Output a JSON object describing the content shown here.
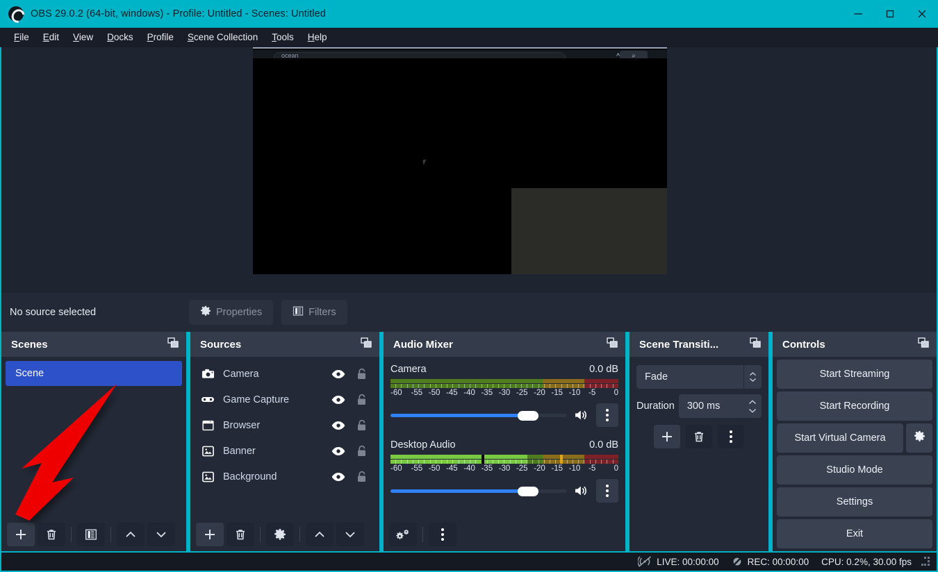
{
  "window": {
    "title": "OBS 29.0.2 (64-bit, windows) - Profile: Untitled - Scenes: Untitled",
    "logo_icon": "obs-logo-icon",
    "minimize_icon": "minimize-icon",
    "maximize_icon": "maximize-icon",
    "close_icon": "close-icon",
    "titlebar_color": "#00b4c8"
  },
  "menubar": {
    "items": [
      {
        "label": "File",
        "mnemonic": "F"
      },
      {
        "label": "Edit",
        "mnemonic": "E"
      },
      {
        "label": "View",
        "mnemonic": "V"
      },
      {
        "label": "Docks",
        "mnemonic": "D"
      },
      {
        "label": "Profile",
        "mnemonic": "P"
      },
      {
        "label": "Scene Collection",
        "mnemonic": "S"
      },
      {
        "label": "Tools",
        "mnemonic": "T"
      },
      {
        "label": "Help",
        "mnemonic": "H"
      }
    ]
  },
  "preview": {
    "captured_window_url_text": "ocean",
    "collapse_icon": "chevron-up-icon",
    "search_icon": "search-icon",
    "cursor_icon": "mouse-cursor-icon"
  },
  "source_toolbar": {
    "status_text": "No source selected",
    "properties_label": "Properties",
    "properties_icon": "gear-icon",
    "filters_label": "Filters",
    "filters_icon": "filters-icon",
    "disabled": "true"
  },
  "scenes_dock": {
    "title": "Scenes",
    "popout_icon": "popout-icon",
    "items": [
      {
        "label": "Scene",
        "selected": true
      }
    ],
    "selected_color": "#2d51c9",
    "toolbar": [
      {
        "name": "add-scene-button",
        "icon": "plus-icon"
      },
      {
        "name": "remove-scene-button",
        "icon": "trash-icon"
      },
      {
        "name": "scene-filters-button",
        "icon": "filters-icon"
      },
      {
        "name": "move-scene-up-button",
        "icon": "chevron-up-icon"
      },
      {
        "name": "move-scene-down-button",
        "icon": "chevron-down-icon"
      }
    ]
  },
  "sources_dock": {
    "title": "Sources",
    "popout_icon": "popout-icon",
    "items": [
      {
        "label": "Camera",
        "icon": "camera-icon",
        "visible": true,
        "locked": false
      },
      {
        "label": "Game Capture",
        "icon": "gamepad-icon",
        "visible": true,
        "locked": false
      },
      {
        "label": "Browser",
        "icon": "browser-window-icon",
        "visible": true,
        "locked": false
      },
      {
        "label": "Banner",
        "icon": "image-icon",
        "visible": true,
        "locked": false
      },
      {
        "label": "Background",
        "icon": "image-icon",
        "visible": true,
        "locked": false
      }
    ],
    "toolbar": [
      {
        "name": "add-source-button",
        "icon": "plus-icon"
      },
      {
        "name": "remove-source-button",
        "icon": "trash-icon"
      },
      {
        "name": "source-properties-button",
        "icon": "gear-icon"
      },
      {
        "name": "move-source-up-button",
        "icon": "chevron-up-icon"
      },
      {
        "name": "move-source-down-button",
        "icon": "chevron-down-icon"
      }
    ]
  },
  "audio_mixer_dock": {
    "title": "Audio Mixer",
    "popout_icon": "popout-icon",
    "scale_labels": [
      "-60",
      "-55",
      "-50",
      "-45",
      "-40",
      "-35",
      "-30",
      "-25",
      "-20",
      "-15",
      "-10",
      "-5",
      "0"
    ],
    "tracks": [
      {
        "name": "Camera",
        "db": "0.0 dB",
        "level_percent": 0,
        "peak_percent": 0,
        "volume_percent": 100,
        "speaker_icon": "speaker-icon",
        "menu_icon": "kebab-menu-icon"
      },
      {
        "name": "Desktop Audio",
        "db": "0.0 dB",
        "level_percent": 60,
        "peak_percent": 40,
        "volume_percent": 100,
        "speaker_icon": "speaker-icon",
        "menu_icon": "kebab-menu-icon"
      }
    ],
    "toolbar": [
      {
        "name": "audio-advanced-properties-button",
        "icon": "gear-settings-icon"
      },
      {
        "name": "audio-mixer-menu-button",
        "icon": "kebab-menu-icon"
      }
    ]
  },
  "transitions_dock": {
    "title": "Scene Transiti...",
    "popout_icon": "popout-icon",
    "transition_value": "Fade",
    "duration_label": "Duration",
    "duration_value": "300 ms",
    "toolbar": [
      {
        "name": "add-transition-button",
        "icon": "plus-icon"
      },
      {
        "name": "remove-transition-button",
        "icon": "trash-icon"
      },
      {
        "name": "transition-menu-button",
        "icon": "kebab-menu-icon"
      }
    ]
  },
  "controls_dock": {
    "title": "Controls",
    "popout_icon": "popout-icon",
    "buttons": [
      {
        "label": "Start Streaming",
        "name": "start-streaming-button"
      },
      {
        "label": "Start Recording",
        "name": "start-recording-button"
      },
      {
        "label": "Start Virtual Camera",
        "name": "start-virtual-camera-button",
        "gear_icon": "gear-icon"
      },
      {
        "label": "Studio Mode",
        "name": "studio-mode-button"
      },
      {
        "label": "Settings",
        "name": "settings-button"
      },
      {
        "label": "Exit",
        "name": "exit-button"
      }
    ]
  },
  "statusbar": {
    "live_icon": "broadcast-off-icon",
    "live_text": "LIVE: 00:00:00",
    "rec_icon": "record-off-icon",
    "rec_text": "REC: 00:00:00",
    "cpu_text": "CPU: 0.2%, 30.00 fps",
    "grip_icon": "resize-grip-icon"
  },
  "annotation": {
    "arrow_color": "#ee0000",
    "points_to": "add-scene-button"
  }
}
